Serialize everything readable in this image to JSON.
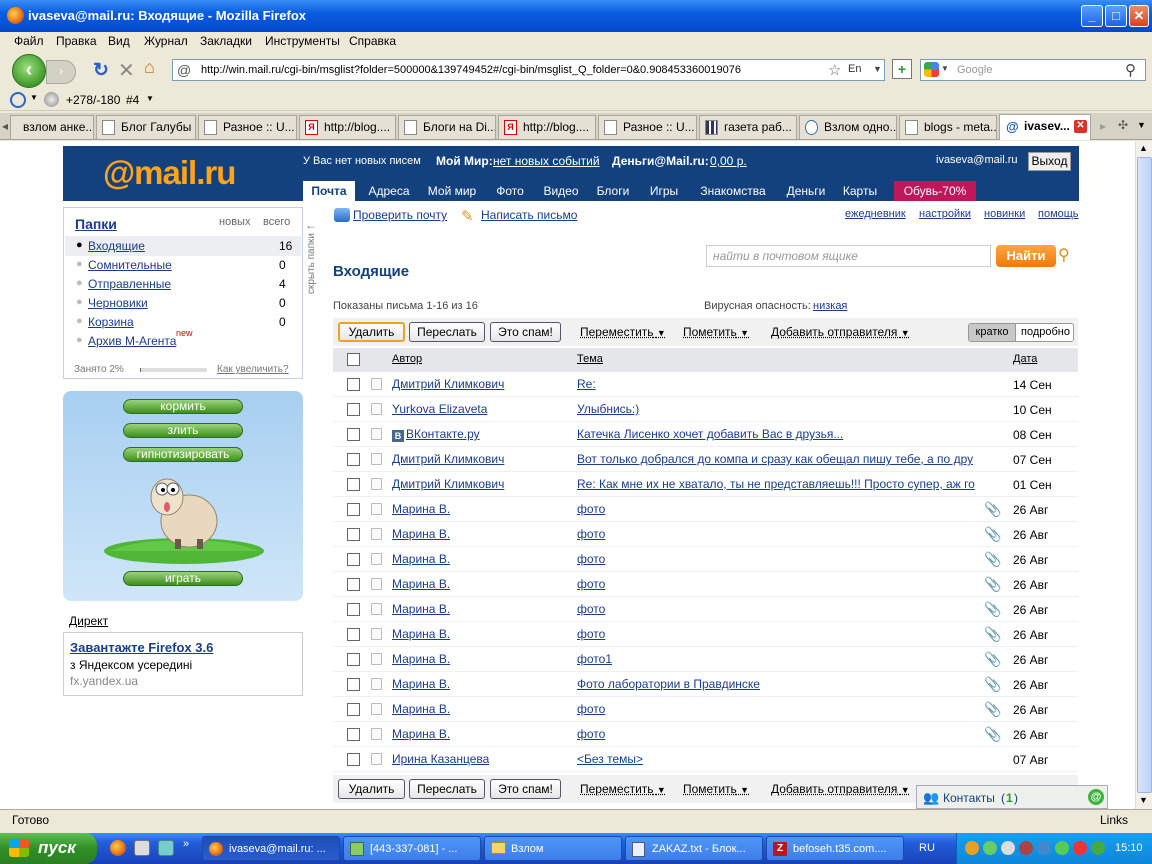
{
  "window": {
    "title": "ivaseva@mail.ru: Входящие - Mozilla Firefox"
  },
  "menu": [
    "Файл",
    "Правка",
    "Вид",
    "Журнал",
    "Закладки",
    "Инструменты",
    "Справка"
  ],
  "nav": {
    "url": "http://win.mail.ru/cgi-bin/msglist?folder=500000&139749452#/cgi-bin/msglist_Q_folder=0&0.908453360019076",
    "search_placeholder": "Google"
  },
  "toolbar2": {
    "rating": "+278/-180",
    "hash": "#4"
  },
  "tabs": [
    "взлом анке...",
    "Блог Галубы",
    "Разное :: U...",
    "http://blog....",
    "Блоги на Di...",
    "http://blog....",
    "Разное :: U...",
    "газета раб...",
    "Взлом одно...",
    "blogs - meta...",
    "ivasev..."
  ],
  "header": {
    "logo_at": "@mail",
    "logo_ru": ".ru",
    "no_new": "У Вас нет новых писем",
    "myworld_label": "Мой Мир:",
    "myworld_link": "нет новых событий",
    "money_label": "Деньги@Mail.ru:",
    "money_link": "0,00 р.",
    "user": "ivaseva@mail.ru",
    "logout": "Выход",
    "tabs": [
      "Почта",
      "Адреса",
      "Мой мир",
      "Фото",
      "Видео",
      "Блоги",
      "Игры",
      "Знакомства",
      "Деньги",
      "Карты",
      "Обувь-70%"
    ]
  },
  "actions": {
    "check": "Проверить почту",
    "write": "Написать письмо",
    "links": [
      "ежедневник",
      "настройки",
      "новинки",
      "помощь"
    ]
  },
  "folders": {
    "title": "Папки",
    "col_new": "новых",
    "col_all": "всего",
    "items": [
      {
        "name": "Входящие",
        "count": "16"
      },
      {
        "name": "Сомнительные",
        "count": "0"
      },
      {
        "name": "Отправленные",
        "count": "4"
      },
      {
        "name": "Черновики",
        "count": "0"
      },
      {
        "name": "Корзина",
        "count": "0"
      },
      {
        "name": "Архив М-Агента",
        "count": ""
      }
    ],
    "new_badge": "new",
    "used": "Занято 2%",
    "used_fraction": 0.02,
    "increase": "Как увеличить?",
    "hide": "скрыть папки"
  },
  "pet": {
    "buttons": [
      "кормить",
      "злить",
      "гипнотизировать"
    ],
    "play": "играть"
  },
  "direct": {
    "label": "Директ",
    "ad_title": "Завантажте Firefox 3.6",
    "ad_text": "з Яндексом усередині",
    "ad_url": "fx.yandex.ua"
  },
  "mail": {
    "title": "Входящие",
    "search_placeholder": "найти в почтовом ящике",
    "search_btn": "Найти",
    "shown": "Показаны письма 1-16 из 16",
    "virus_label": "Вирусная опасность:",
    "virus_value": "низкая",
    "btn_delete": "Удалить",
    "btn_forward": "Переслать",
    "btn_spam": "Это спам!",
    "btn_move": "Переместить",
    "btn_mark": "Пометить",
    "btn_addsender": "Добавить отправителя",
    "view_short": "кратко",
    "view_full": "подробно",
    "col_author": "Автор",
    "col_subject": "Тема",
    "col_date": "Дата",
    "rows": [
      {
        "author": "Дмитрий Климкович",
        "subject": "Re:",
        "date": "14 Сен",
        "clip": false
      },
      {
        "author": "Yurkova Elizaveta",
        "subject": "Улыбнись:)",
        "date": "10 Сен",
        "clip": false
      },
      {
        "author": "ВКонтакте.ру",
        "subject": "Катечка Лисенко хочет добавить Вас в друзья...",
        "date": "08 Сен",
        "clip": false,
        "vk": true
      },
      {
        "author": "Дмитрий Климкович",
        "subject": "Вот только добрался до компа и сразу как обещал пишу тебе, а по дру",
        "date": "07 Сен",
        "clip": false
      },
      {
        "author": "Дмитрий Климкович",
        "subject": "Re: Как мне их не хватало, ты не представляешь!!! Просто супер, аж го",
        "date": "01 Сен",
        "clip": false
      },
      {
        "author": "Марина В.",
        "subject": "фото",
        "date": "26 Авг",
        "clip": true
      },
      {
        "author": "Марина В.",
        "subject": "фото",
        "date": "26 Авг",
        "clip": true
      },
      {
        "author": "Марина В.",
        "subject": "фото",
        "date": "26 Авг",
        "clip": true
      },
      {
        "author": "Марина В.",
        "subject": "фото",
        "date": "26 Авг",
        "clip": true
      },
      {
        "author": "Марина В.",
        "subject": "фото",
        "date": "26 Авг",
        "clip": true
      },
      {
        "author": "Марина В.",
        "subject": "фото",
        "date": "26 Авг",
        "clip": true
      },
      {
        "author": "Марина В.",
        "subject": "фото1",
        "date": "26 Авг",
        "clip": true
      },
      {
        "author": "Марина В.",
        "subject": "Фото лаборатории в Правдинске",
        "date": "26 Авг",
        "clip": true
      },
      {
        "author": "Марина В.",
        "subject": "фото",
        "date": "26 Авг",
        "clip": true
      },
      {
        "author": "Марина В.",
        "subject": "фото",
        "date": "26 Авг",
        "clip": true
      },
      {
        "author": "Ирина Казанцева",
        "subject": "<Без темы>",
        "date": "07 Авг",
        "clip": false
      }
    ]
  },
  "contacts": {
    "label": "Контакты",
    "count": "1"
  },
  "status": {
    "text": "Готово",
    "links": "Links"
  },
  "taskbar": {
    "start": "пуск",
    "tasks": [
      "ivaseva@mail.ru: ...",
      "[443-337-081] - ...",
      "Взлом",
      "ZAKAZ.txt - Блок...",
      "befoseh.t35.com...."
    ],
    "lang": "RU",
    "time": "15:10"
  }
}
